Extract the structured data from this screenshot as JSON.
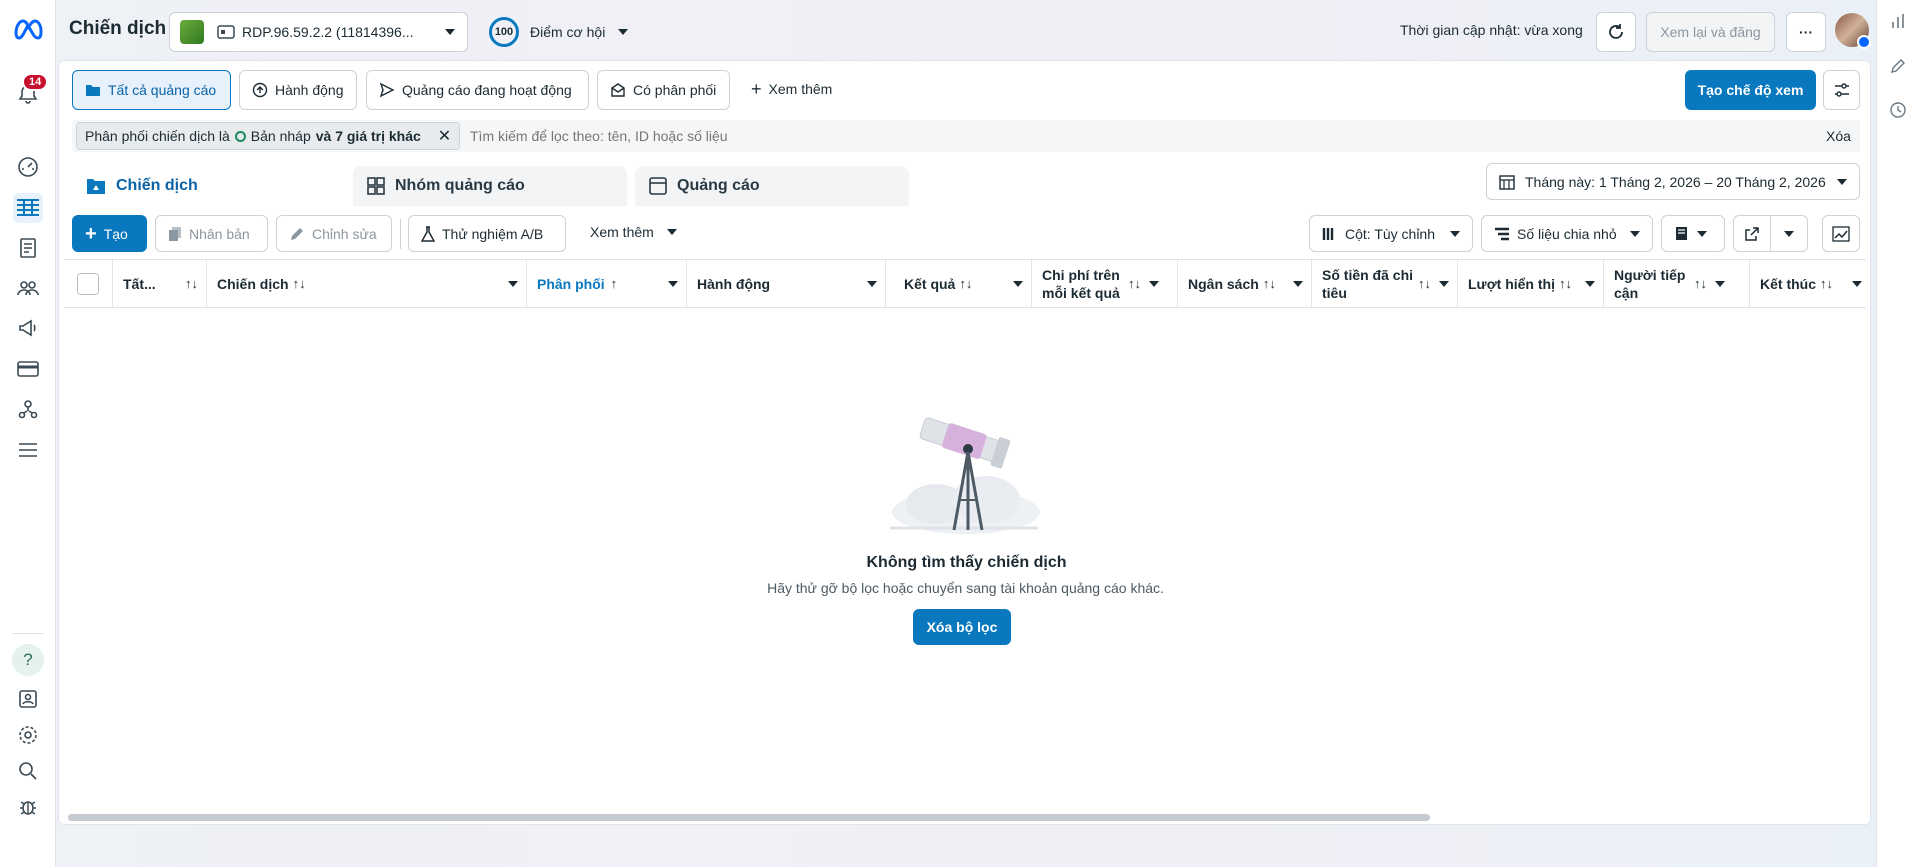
{
  "header": {
    "title": "Chiến dịch",
    "account": "RDP.96.59.2.2 (11814396...",
    "score": "100",
    "opportunity_label": "Điểm cơ hội",
    "update_time": "Thời gian cập nhật: vừa xong",
    "review_button": "Xem lại và đăng",
    "more_button": "···"
  },
  "leftnav": {
    "notifications_count": "14"
  },
  "filters": {
    "all_ads": "Tất cả quảng cáo",
    "actions": "Hành động",
    "active_ads": "Quảng cáo đang hoạt động",
    "with_delivery": "Có phân phối",
    "see_more": "Xem thêm",
    "create_view": "Tạo chế độ xem"
  },
  "filter_bar": {
    "chip_prefix": "Phân phối chiến dịch là",
    "chip_value": "Bản nháp",
    "chip_suffix": "và 7 giá trị khác",
    "search_placeholder": "Tìm kiếm để lọc theo: tên, ID hoặc số liệu",
    "clear": "Xóa"
  },
  "level_tabs": {
    "campaigns": "Chiến dịch",
    "adsets": "Nhóm quảng cáo",
    "ads": "Quảng cáo"
  },
  "date_range": "Tháng này: 1 Tháng 2, 2026 – 20 Tháng 2, 2026",
  "toolbar": {
    "create": "Tạo",
    "duplicate": "Nhân bản",
    "edit": "Chỉnh sửa",
    "ab_test": "Thử nghiệm A/B",
    "more": "Xem thêm",
    "columns": "Cột: Tùy chỉnh",
    "breakdown": "Số liệu chia nhỏ"
  },
  "table": {
    "columns": [
      "Tất...",
      "Chiến dịch",
      "Phân phối",
      "Hành động",
      "Kết quả",
      "Chi phí trên mỗi kết quả",
      "Ngân sách",
      "Số tiền đã chi tiêu",
      "Lượt hiển thị",
      "Người tiếp cận",
      "Kết thúc"
    ]
  },
  "empty": {
    "title": "Không tìm thấy chiến dịch",
    "subtitle": "Hãy thử gỡ bộ lọc hoặc chuyển sang tài khoản quảng cáo khác.",
    "button": "Xóa bộ lọc"
  },
  "colors": {
    "accent": "#0a78be",
    "badge": "#c8102e"
  }
}
